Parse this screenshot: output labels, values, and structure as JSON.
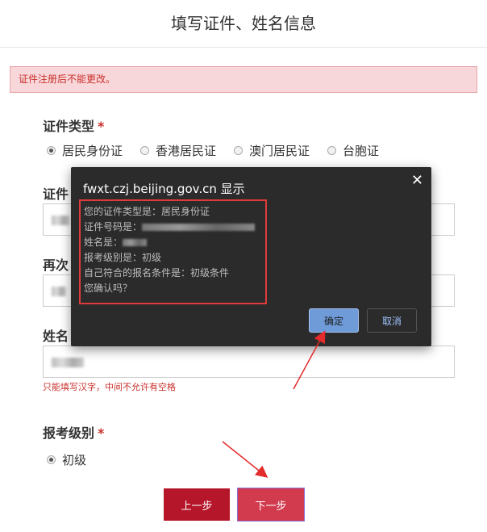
{
  "page": {
    "title": "填写证件、姓名信息"
  },
  "notice": {
    "text": "证件注册后不能更改。"
  },
  "form": {
    "id_type": {
      "label": "证件类型",
      "required_mark": "*",
      "options": [
        "居民身份证",
        "香港居民证",
        "澳门居民证",
        "台胞证"
      ],
      "selected": "居民身份证"
    },
    "id_number": {
      "label_visible": "证件"
    },
    "id_number_confirm": {
      "label_visible": "再次"
    },
    "name": {
      "label_visible": "姓名",
      "hint": "只能填写汉字，中间不允许有空格"
    },
    "level": {
      "label": "报考级别",
      "required_mark": "*",
      "options": [
        "初级"
      ],
      "selected": "初级"
    },
    "prev_button": "上一步",
    "next_button": "下一步"
  },
  "dialog": {
    "title": "fwxt.czj.beijing.gov.cn 显示",
    "close_glyph": "✕",
    "lines": {
      "id_type": "您的证件类型是：居民身份证",
      "id_number_prefix": "证件号码是：",
      "name_prefix": "姓名是：",
      "level": "报考级别是：初级",
      "condition": "自己符合的报名条件是：初级条件",
      "confirm": "您确认吗？"
    },
    "ok_label": "确定",
    "cancel_label": "取消"
  },
  "colors": {
    "accent_red": "#b5162a",
    "notice_bg": "#f8d7da",
    "dialog_bg": "#2b2b2b",
    "highlight_border": "#e03a3a"
  }
}
